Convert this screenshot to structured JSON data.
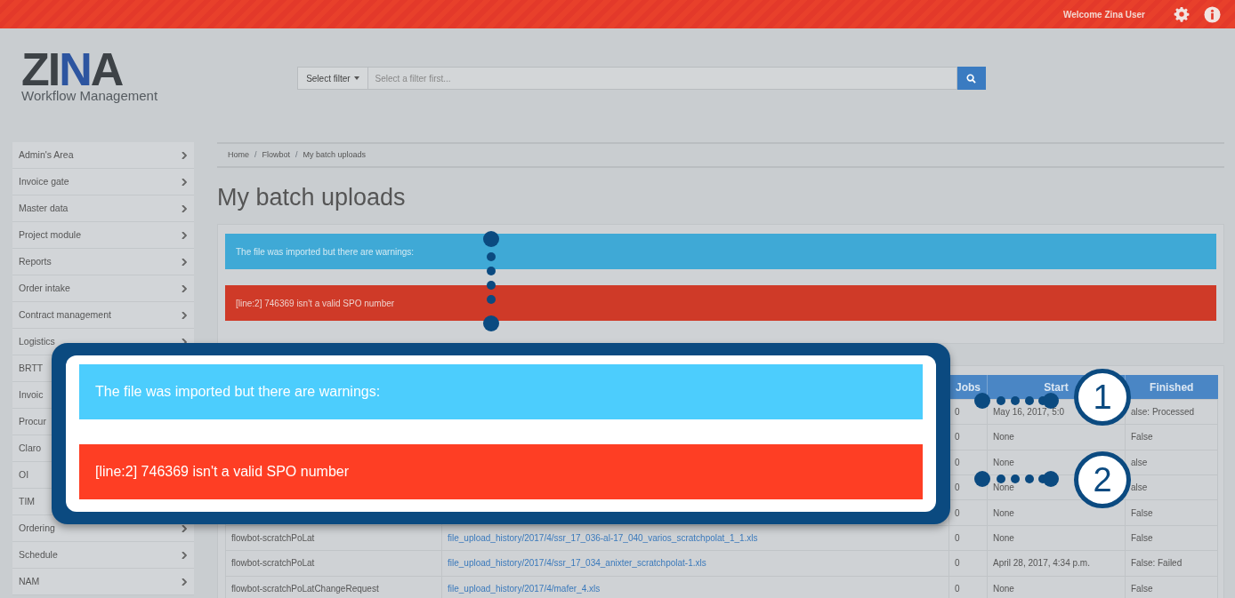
{
  "topbar": {
    "welcome": "Welcome Zina User"
  },
  "logo": {
    "title": "ZINA",
    "subtitle": "Workflow Management"
  },
  "search": {
    "filter_button": "Select filter",
    "placeholder": "Select a filter first..."
  },
  "sidebar": {
    "items": [
      "Admin's Area",
      "Invoice gate",
      "Master data",
      "Project module",
      "Reports",
      "Order intake",
      "Contract management",
      "Logistics",
      "BRTT",
      "Invoic",
      "Procur",
      "Claro",
      "OI",
      "TIM",
      "Ordering",
      "Schedule",
      "NAM"
    ]
  },
  "breadcrumb": {
    "items": [
      "Home",
      "Flowbot",
      "My batch uploads"
    ],
    "separator": "/"
  },
  "page_title": "My batch uploads",
  "alerts": [
    {
      "kind": "info",
      "text": "The file was imported but there are warnings:"
    },
    {
      "kind": "danger",
      "text": "[line:2] 746369 isn't a valid SPO number"
    }
  ],
  "table": {
    "columns": [
      "Jobs",
      "Start",
      "Finished"
    ],
    "rows": [
      {
        "jobs": "0",
        "start": "May 16, 2017, 5:0",
        "finished": "alse: Processed"
      },
      {
        "jobs": "0",
        "start": "None",
        "finished": "False"
      },
      {
        "jobs": "0",
        "start": "None",
        "finished": "alse"
      },
      {
        "jobs": "0",
        "start": "None",
        "finished": "alse"
      },
      {
        "jobs": "0",
        "start": "None",
        "finished": "False"
      },
      {
        "name": "flowbot-scratchPoLat",
        "file": "file_upload_history/2017/4/ssr_17_036-al-17_040_varios_scratchpolat_1_1.xls",
        "jobs": "0",
        "start": "None",
        "finished": "False"
      },
      {
        "name": "flowbot-scratchPoLat",
        "file": "file_upload_history/2017/4/ssr_17_034_anixter_scratchpolat-1.xls",
        "jobs": "0",
        "start": "April 28, 2017, 4:34 p.m.",
        "finished": "False: Failed"
      },
      {
        "name": "flowbot-scratchPoLatChangeRequest",
        "file": "file_upload_history/2017/4/mafer_4.xls",
        "jobs": "0",
        "start": "None",
        "finished": "False"
      }
    ]
  },
  "callout": {
    "alerts": [
      {
        "kind": "info",
        "text": "The file was imported but there are warnings:"
      },
      {
        "kind": "danger",
        "text": "[line:2] 746369 isn't a valid SPO number"
      }
    ],
    "markers": [
      "1",
      "2"
    ]
  }
}
